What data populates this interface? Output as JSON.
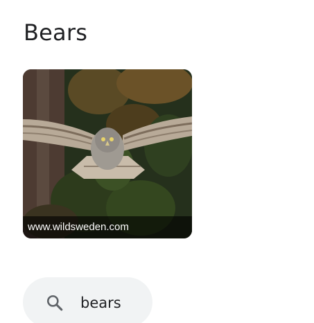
{
  "section": {
    "title": "Bears"
  },
  "image_card": {
    "subject": "great grey owl in flight over forest",
    "source": "www.wildsweden.com"
  },
  "search_chip": {
    "icon": "search-icon",
    "label": "bears"
  },
  "colors": {
    "text": "#202124",
    "chip_bg": "#f1f3f4",
    "icon": "#5f6368"
  }
}
